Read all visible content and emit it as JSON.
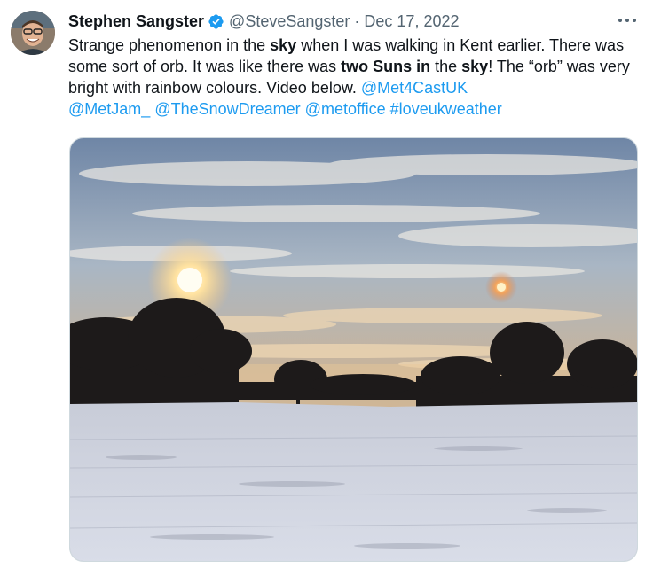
{
  "author": {
    "name": "Stephen Sangster",
    "handle": "@SteveSangster",
    "separator": "·",
    "date": "Dec 17, 2022"
  },
  "icons": {
    "verified": "verified-badge-icon",
    "more": "more-options-icon",
    "verified_color": "#1d9bf0"
  },
  "tweet": {
    "t1": "Strange phenomenon in the ",
    "b1": "sky",
    "t2": " when I was walking in Kent earlier.   There was some sort of orb.  It was like there was ",
    "b2": "two Suns in",
    "t3": " the ",
    "b3": "sky",
    "t4": "!  The “orb” was very bright with rainbow colours. Video below.  ",
    "mentions": [
      "@Met4CastUK",
      "@MetJam_",
      "@TheSnowDreamer",
      "@metoffice"
    ],
    "hashtag": "#loveukweather"
  },
  "colors": {
    "link": "#1d9bf0",
    "text": "#0f1419",
    "secondary": "#536471"
  }
}
